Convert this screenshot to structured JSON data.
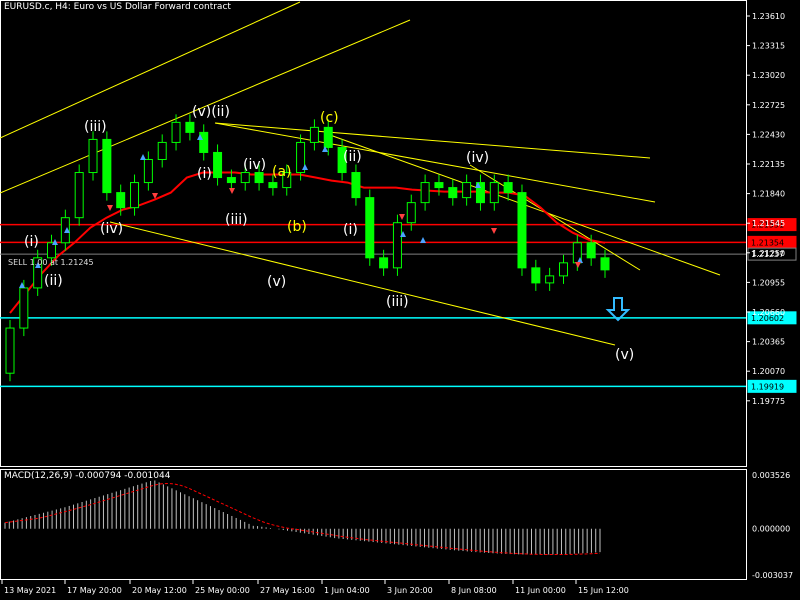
{
  "header": {
    "symbol_title": "EURUSD.c, H4:  Euro vs US Dollar Forward contract",
    "macd_label": "MACD(12,26,9) -0.000794 -0.001044",
    "sell_label": "SELL 1.00 at 1.21245"
  },
  "colors": {
    "background": "#000000",
    "candles": "#00ff00",
    "ma": "#ff0000",
    "channel": "#ffff00",
    "level_red": "#ff0000",
    "level_cyan": "#00ffff",
    "macd_hist": "#c0c0c0",
    "macd_signal": "#ff0000",
    "bid_line": "#808080"
  },
  "chart_data": [
    {
      "type": "candlestick",
      "title": "EURUSD.c, H4:  Euro vs US Dollar Forward contract",
      "y_ticks": [
        "1.23610",
        "1.23315",
        "1.23020",
        "1.22725",
        "1.22430",
        "1.22135",
        "1.21840",
        "1.21545",
        "1.21250",
        "1.20955",
        "1.20660",
        "1.20365",
        "1.20070",
        "1.19775"
      ],
      "ylim": [
        1.1967,
        1.2368
      ],
      "x_ticks": [
        "13 May 2021",
        "17 May 20:00",
        "20 May 12:00",
        "25 May 00:00",
        "27 May 16:00",
        "1 Jun 04:00",
        "3 Jun 20:00",
        "8 Jun 08:00",
        "11 Jun 00:00",
        "15 Jun 12:00"
      ],
      "series": [
        {
          "name": "price_close",
          "values": [
            1.205,
            1.209,
            1.212,
            1.2135,
            1.216,
            1.2205,
            1.2238,
            1.2185,
            1.217,
            1.2195,
            1.2218,
            1.2235,
            1.2255,
            1.2245,
            1.2225,
            1.22,
            1.2195,
            1.2205,
            1.2195,
            1.219,
            1.2205,
            1.2235,
            1.225,
            1.223,
            1.2205,
            1.218,
            1.212,
            1.211,
            1.2155,
            1.2175,
            1.2195,
            1.219,
            1.218,
            1.2195,
            1.2175,
            1.2195,
            1.2185,
            1.211,
            1.2095,
            1.2102,
            1.2115,
            1.2135,
            1.212,
            1.2108
          ]
        },
        {
          "name": "ma",
          "values": [
            1.2065,
            1.2085,
            1.2105,
            1.2122,
            1.2135,
            1.215,
            1.216,
            1.2168,
            1.2172,
            1.2178,
            1.2185,
            1.22,
            1.2205,
            1.2205,
            1.2205,
            1.2203,
            1.2203,
            1.2203,
            1.2203,
            1.22,
            1.2197,
            1.2195,
            1.219,
            1.219,
            1.219,
            1.2188,
            1.2187,
            1.2186,
            1.2186,
            1.2186,
            1.2185,
            1.2185,
            1.2182,
            1.217,
            1.2155,
            1.2145,
            1.2138,
            1.2135
          ]
        }
      ],
      "horizontal_levels": [
        {
          "value": 1.21531,
          "label": "1.21531",
          "color": "red"
        },
        {
          "value": 1.21354,
          "label": "1.21354",
          "color": "red"
        },
        {
          "value": 1.21237,
          "label": "1.21237",
          "color": "gray"
        },
        {
          "value": 1.20602,
          "label": "1.20602",
          "color": "cyan"
        },
        {
          "value": 1.19919,
          "label": "1.19919",
          "color": "cyan"
        }
      ],
      "wave_labels": [
        "(i)",
        "(ii)",
        "(iii)",
        "(iv)",
        "(v)(ii)",
        "(i)",
        "(iii)",
        "(iv)",
        "(a)",
        "(b)",
        "(v)",
        "(c)",
        "(ii)",
        "(i)",
        "(iii)",
        "(iv)",
        "(v)"
      ]
    },
    {
      "type": "bar",
      "title": "MACD(12,26,9) -0.000794 -0.001044",
      "y_ticks": [
        "0.003526",
        "0.000000",
        "-0.003037"
      ],
      "ylim": [
        -0.003037,
        0.003526
      ],
      "main_value": -0.000794,
      "signal_value": -0.001044
    }
  ]
}
